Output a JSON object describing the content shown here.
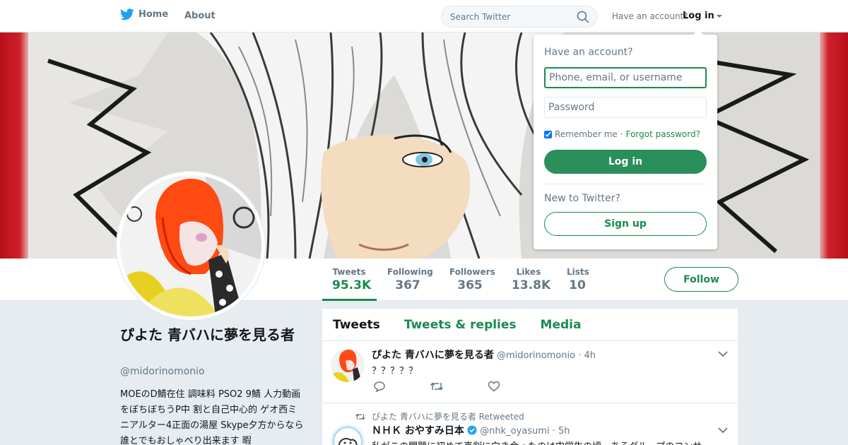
{
  "nav": {
    "home_label": "Home",
    "about_label": "About",
    "search_placeholder": "Search Twitter",
    "account_prompt": "Have an account?",
    "login_label": "Log in"
  },
  "profile": {
    "name": "ぴよた 青バハに夢を見る者",
    "handle": "@midorinomonio",
    "bio": "MOEのD鯖在住 調味料 PSO2 9鯖 人力動画をぼちぼちうP中 割と自己中心的 ゲオ西ミニアルター4正面の湯屋 Skype夕方からなら誰とでもおしゃべり出来ます 暇",
    "follow_label": "Follow"
  },
  "stats": [
    {
      "label": "Tweets",
      "value": "95.3K"
    },
    {
      "label": "Following",
      "value": "367"
    },
    {
      "label": "Followers",
      "value": "365"
    },
    {
      "label": "Likes",
      "value": "13.8K"
    },
    {
      "label": "Lists",
      "value": "10"
    }
  ],
  "timeline": {
    "tabs": [
      "Tweets",
      "Tweets & replies",
      "Media"
    ],
    "tweet1": {
      "name": "ぴよた 青バハに夢を見る者",
      "handle": "@midorinomonio",
      "time": "4h",
      "text": "？？？？？"
    },
    "tweet2": {
      "retweet_note": "ぴよた 青バハに夢を見る者 Retweeted",
      "name": "ＮＨＫ おやすみ日本",
      "handle": "@nhk_oyasumi",
      "time": "5h",
      "text": "私がこの問題に初めて真剣に向き合ったのは中学生の頃、あるグループのコンサ"
    }
  },
  "login_dropdown": {
    "title": "Have an account?",
    "username_placeholder": "Phone, email, or username",
    "password_placeholder": "Password",
    "remember_label": "Remember me",
    "separator": "·",
    "forgot_label": "Forgot password?",
    "login_button": "Log in",
    "new_prompt": "New to Twitter?",
    "signup_button": "Sign up"
  },
  "colors": {
    "accent": "#1b8a4f",
    "twitter_blue": "#1da1f2",
    "banner_red": "#c0101a"
  }
}
